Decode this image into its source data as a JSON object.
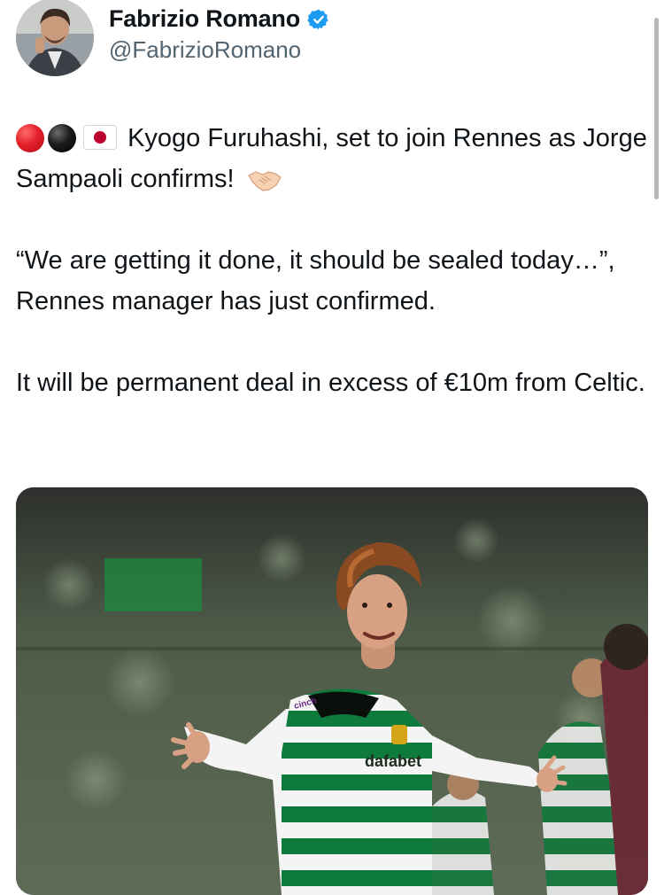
{
  "author": {
    "display_name": "Fabrizio Romano",
    "handle": "@FabrizioRomano",
    "verified_icon": "verified-badge-icon",
    "verified_color": "#1d9bf0"
  },
  "tweet": {
    "emojis": [
      "red-circle",
      "black-circle",
      "japan-flag",
      "handshake"
    ],
    "line1_text": "Kyogo Furuhashi, set to join Rennes as Jorge Sampaoli confirms!",
    "quote": "“We are getting it done, it should be sealed today…”, Rennes manager has just confirmed.",
    "detail": "It will be permanent deal in excess of €10m from Celtic."
  },
  "media": {
    "kind": "photo",
    "kit_sponsor": "dafabet",
    "sleeve_sponsor": "cinch"
  },
  "colors": {
    "text": "#0f1419",
    "secondary_text": "#536471",
    "accent": "#1d9bf0"
  }
}
